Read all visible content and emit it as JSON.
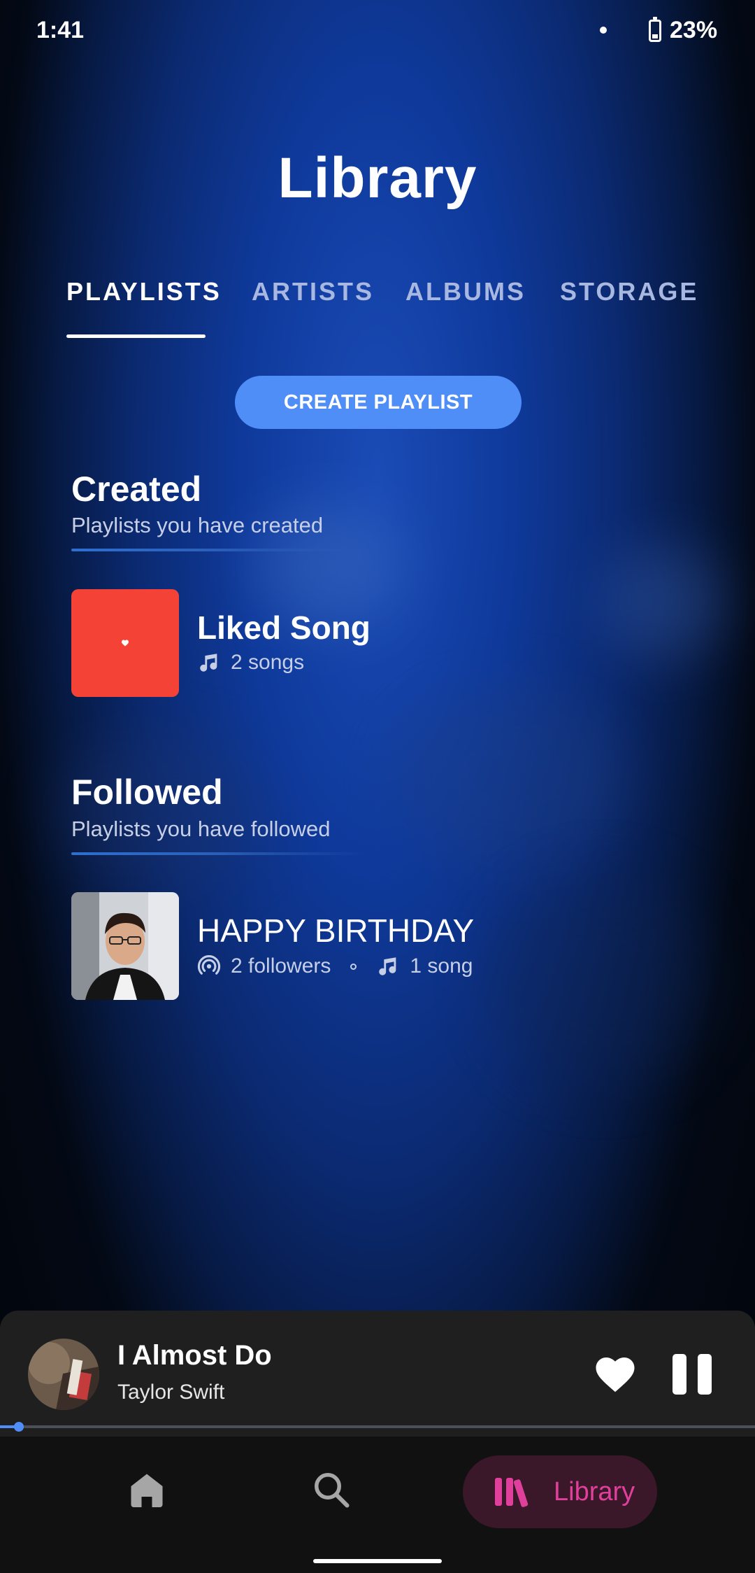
{
  "status_bar": {
    "time": "1:41",
    "battery": "23%"
  },
  "header": {
    "title": "Library"
  },
  "tabs": [
    {
      "label": "PLAYLISTS",
      "active": true
    },
    {
      "label": "ARTISTS",
      "active": false
    },
    {
      "label": "ALBUMS",
      "active": false
    },
    {
      "label": "STORAGE",
      "active": false
    }
  ],
  "create_button": {
    "label": "CREATE PLAYLIST"
  },
  "created": {
    "title": "Created",
    "subtitle": "Playlists you have created",
    "items": [
      {
        "title": "Liked Song",
        "songs": "2 songs",
        "icon": "music-note-icon",
        "cover_color": "#f44336"
      }
    ]
  },
  "followed": {
    "title": "Followed",
    "subtitle": "Playlists you have followed",
    "items": [
      {
        "title": "HAPPY BIRTHDAY",
        "followers": "2 followers",
        "songs": "1 song",
        "icons": [
          "podcast-icon",
          "music-note-icon"
        ]
      }
    ]
  },
  "player": {
    "title": "I Almost Do",
    "artist": "Taylor Swift",
    "progress": 0.025,
    "accent": "#4f8ef7"
  },
  "nav": {
    "items": [
      "home-icon",
      "search-icon",
      "library-icon"
    ],
    "library_label": "Library",
    "active_color": "#e0409b"
  }
}
